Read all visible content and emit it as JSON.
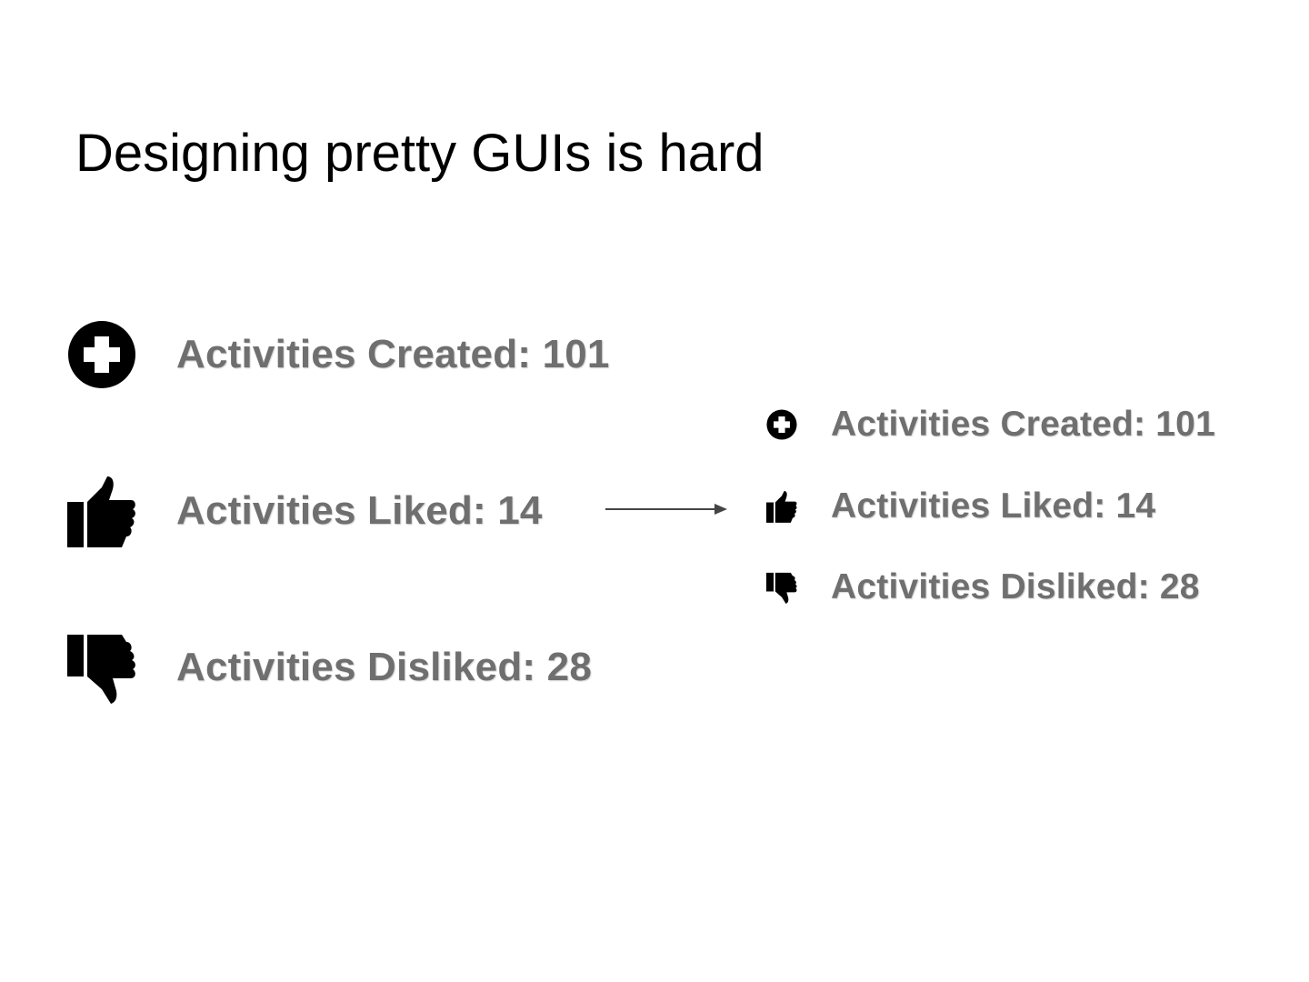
{
  "slide": {
    "title": "Designing pretty GUIs is hard"
  },
  "before": {
    "items": [
      {
        "icon": "plus-circle-icon",
        "label": "Activities Created: 101"
      },
      {
        "icon": "thumbs-up-icon",
        "label": "Activities Liked: 14"
      },
      {
        "icon": "thumbs-down-icon",
        "label": "Activities Disliked: 28"
      }
    ]
  },
  "after": {
    "items": [
      {
        "icon": "plus-circle-icon",
        "label": "Activities Created: 101"
      },
      {
        "icon": "thumbs-up-icon",
        "label": "Activities Liked: 14"
      },
      {
        "icon": "thumbs-down-icon",
        "label": "Activities Disliked: 28"
      }
    ]
  },
  "colors": {
    "label_text": "#6f6f6f",
    "icon": "#000000",
    "arrow": "#444444",
    "background": "#ffffff"
  }
}
